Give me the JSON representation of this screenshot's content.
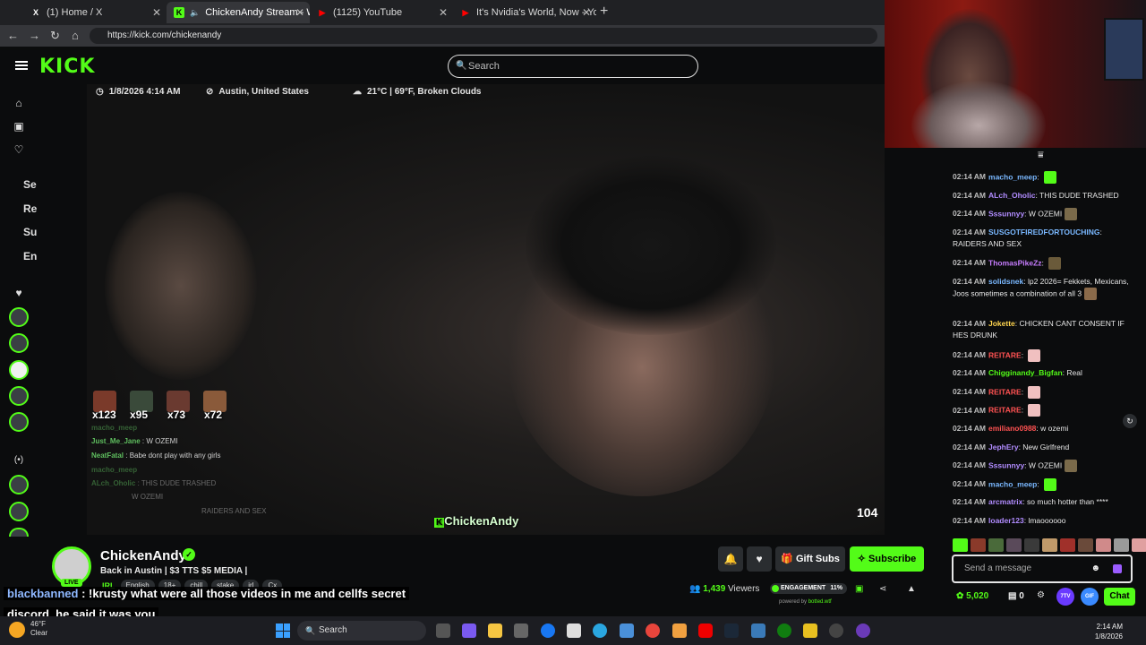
{
  "browser": {
    "tabs": [
      {
        "title": "(1) Home / X",
        "fav": "X",
        "fav_color": "#000000"
      },
      {
        "title": "ChickenAndy Stream - Watch",
        "fav": "K",
        "fav_color": "#53fc18"
      },
      {
        "title": "(1125) YouTube",
        "fav": "▶",
        "fav_color": "#ff0000"
      },
      {
        "title": "It's Nvidia's World, Now - YouTube",
        "fav": "▶",
        "fav_color": "#ff0000"
      }
    ],
    "url": "https://kick.com/chickenandy"
  },
  "kick": {
    "logo": "KICK",
    "search_placeholder": "Search"
  },
  "sidebar": {
    "abbr": [
      "Se",
      "Re",
      "Su",
      "En"
    ]
  },
  "video": {
    "datetime": "1/8/2026 4:14 AM",
    "location": "Austin, United States",
    "weather": "21°C | 69°F, Broken Clouds",
    "emote_counts": [
      "x123",
      "x95",
      "x73",
      "x72"
    ],
    "overlay_chat": [
      {
        "user": "macho_meep",
        "text": ""
      },
      {
        "user": "Just_Me_Jane",
        "text": "W OZEMI"
      },
      {
        "user": "NeatFatal",
        "text": "Babe dont play with any girls"
      },
      {
        "user": "macho_meep",
        "text": ""
      },
      {
        "user": "ALch_Oholic",
        "text": "THIS DUDE TRASHED"
      },
      {
        "user": "",
        "text": "W OZEMI"
      },
      {
        "user": "",
        "text": "RAIDERS AND SEX"
      }
    ],
    "watermark": "ChickenAndy",
    "badge_number": "104"
  },
  "stream": {
    "channel": "ChickenAndy",
    "title": "Back in Austin | $3 TTS $5 MEDIA |",
    "live": "LIVE",
    "category": "IRL",
    "tags": [
      "English",
      "18+",
      "chill",
      "stake",
      "irl",
      "Cx"
    ],
    "gift_label": "Gift Subs",
    "subscribe_label": "Subscribe",
    "viewers_count": "1,439",
    "viewers_label": "Viewers",
    "engagement_label": "ENGAGEMENT",
    "engagement_pct": "11%",
    "engagement_level": 0.11,
    "powered_by": "powered by",
    "powered_brand": "botted.wtf"
  },
  "caption": {
    "user": "blackbanned",
    "line1": " : !krusty what were all those videos in me and cellfs secret",
    "line2": "discord. he said it was you"
  },
  "chat": {
    "messages": [
      {
        "time": "02:14 AM",
        "user": "macho_meep",
        "color": "#7ab8ff",
        "text": "",
        "emote": "#53fc18"
      },
      {
        "time": "02:14 AM",
        "user": "ALch_Oholic",
        "color": "#b18cff",
        "text": "THIS DUDE TRASHED",
        "emote": ""
      },
      {
        "time": "02:14 AM",
        "user": "Sssunnyy",
        "color": "#b18cff",
        "text": "W OZEMI",
        "emote": "#7a6a4a"
      },
      {
        "time": "02:14 AM",
        "user": "SUSGOTFIREDFORTOUCHING",
        "color": "#7ab8ff",
        "text": "RAIDERS AND SEX",
        "emote": ""
      },
      {
        "time": "02:14 AM",
        "user": "ThomasPikeZz",
        "color": "#c77dff",
        "text": "",
        "emote": "#6a5a3a"
      },
      {
        "time": "02:14 AM",
        "user": "solidsnek",
        "color": "#7ab8ff",
        "text": "lp2 2026= Fekkets, Mexicans, Joos sometimes a combination of all 3",
        "emote": "#8a6a4a"
      },
      {
        "time": "02:14 AM",
        "user": "Jokette",
        "color": "#ffd54f",
        "text": "CHICKEN CANT CONSENT IF HES DRUNK",
        "emote": ""
      },
      {
        "time": "02:14 AM",
        "user": "REITARE",
        "color": "#ff5252",
        "text": "",
        "emote": "#f0c0c0"
      },
      {
        "time": "02:14 AM",
        "user": "Chigginandy_Bigfan",
        "color": "#53fc18",
        "text": "Real",
        "emote": ""
      },
      {
        "time": "02:14 AM",
        "user": "REITARE",
        "color": "#ff5252",
        "text": "",
        "emote": "#f0c0c0"
      },
      {
        "time": "02:14 AM",
        "user": "REITARE",
        "color": "#ff5252",
        "text": "",
        "emote": "#f0c0c0"
      },
      {
        "time": "02:14 AM",
        "user": "emiliano0988",
        "color": "#ff5252",
        "text": "w ozemi",
        "emote": ""
      },
      {
        "time": "02:14 AM",
        "user": "JephEry",
        "color": "#b18cff",
        "text": "New Girlfrend",
        "emote": ""
      },
      {
        "time": "02:14 AM",
        "user": "Sssunnyy",
        "color": "#b18cff",
        "text": "W OZEMI",
        "emote": "#7a6a4a"
      },
      {
        "time": "02:14 AM",
        "user": "macho_meep",
        "color": "#7ab8ff",
        "text": "",
        "emote": "#53fc18"
      },
      {
        "time": "02:14 AM",
        "user": "arcmatrix",
        "color": "#b18cff",
        "text": "so much hotter than ****",
        "emote": ""
      },
      {
        "time": "02:14 AM",
        "user": "loader123",
        "color": "#b18cff",
        "text": "lmaoooooo",
        "emote": ""
      }
    ],
    "input_placeholder": "Send a message",
    "points": "5,020",
    "count": "0",
    "circle_a": "7TV",
    "circle_b": "GIF",
    "chat_button": "Chat"
  },
  "taskbar": {
    "temp": "46°F",
    "condition": "Clear",
    "search_label": "Search",
    "time": "2:14 AM",
    "date": "1/8/2026"
  }
}
